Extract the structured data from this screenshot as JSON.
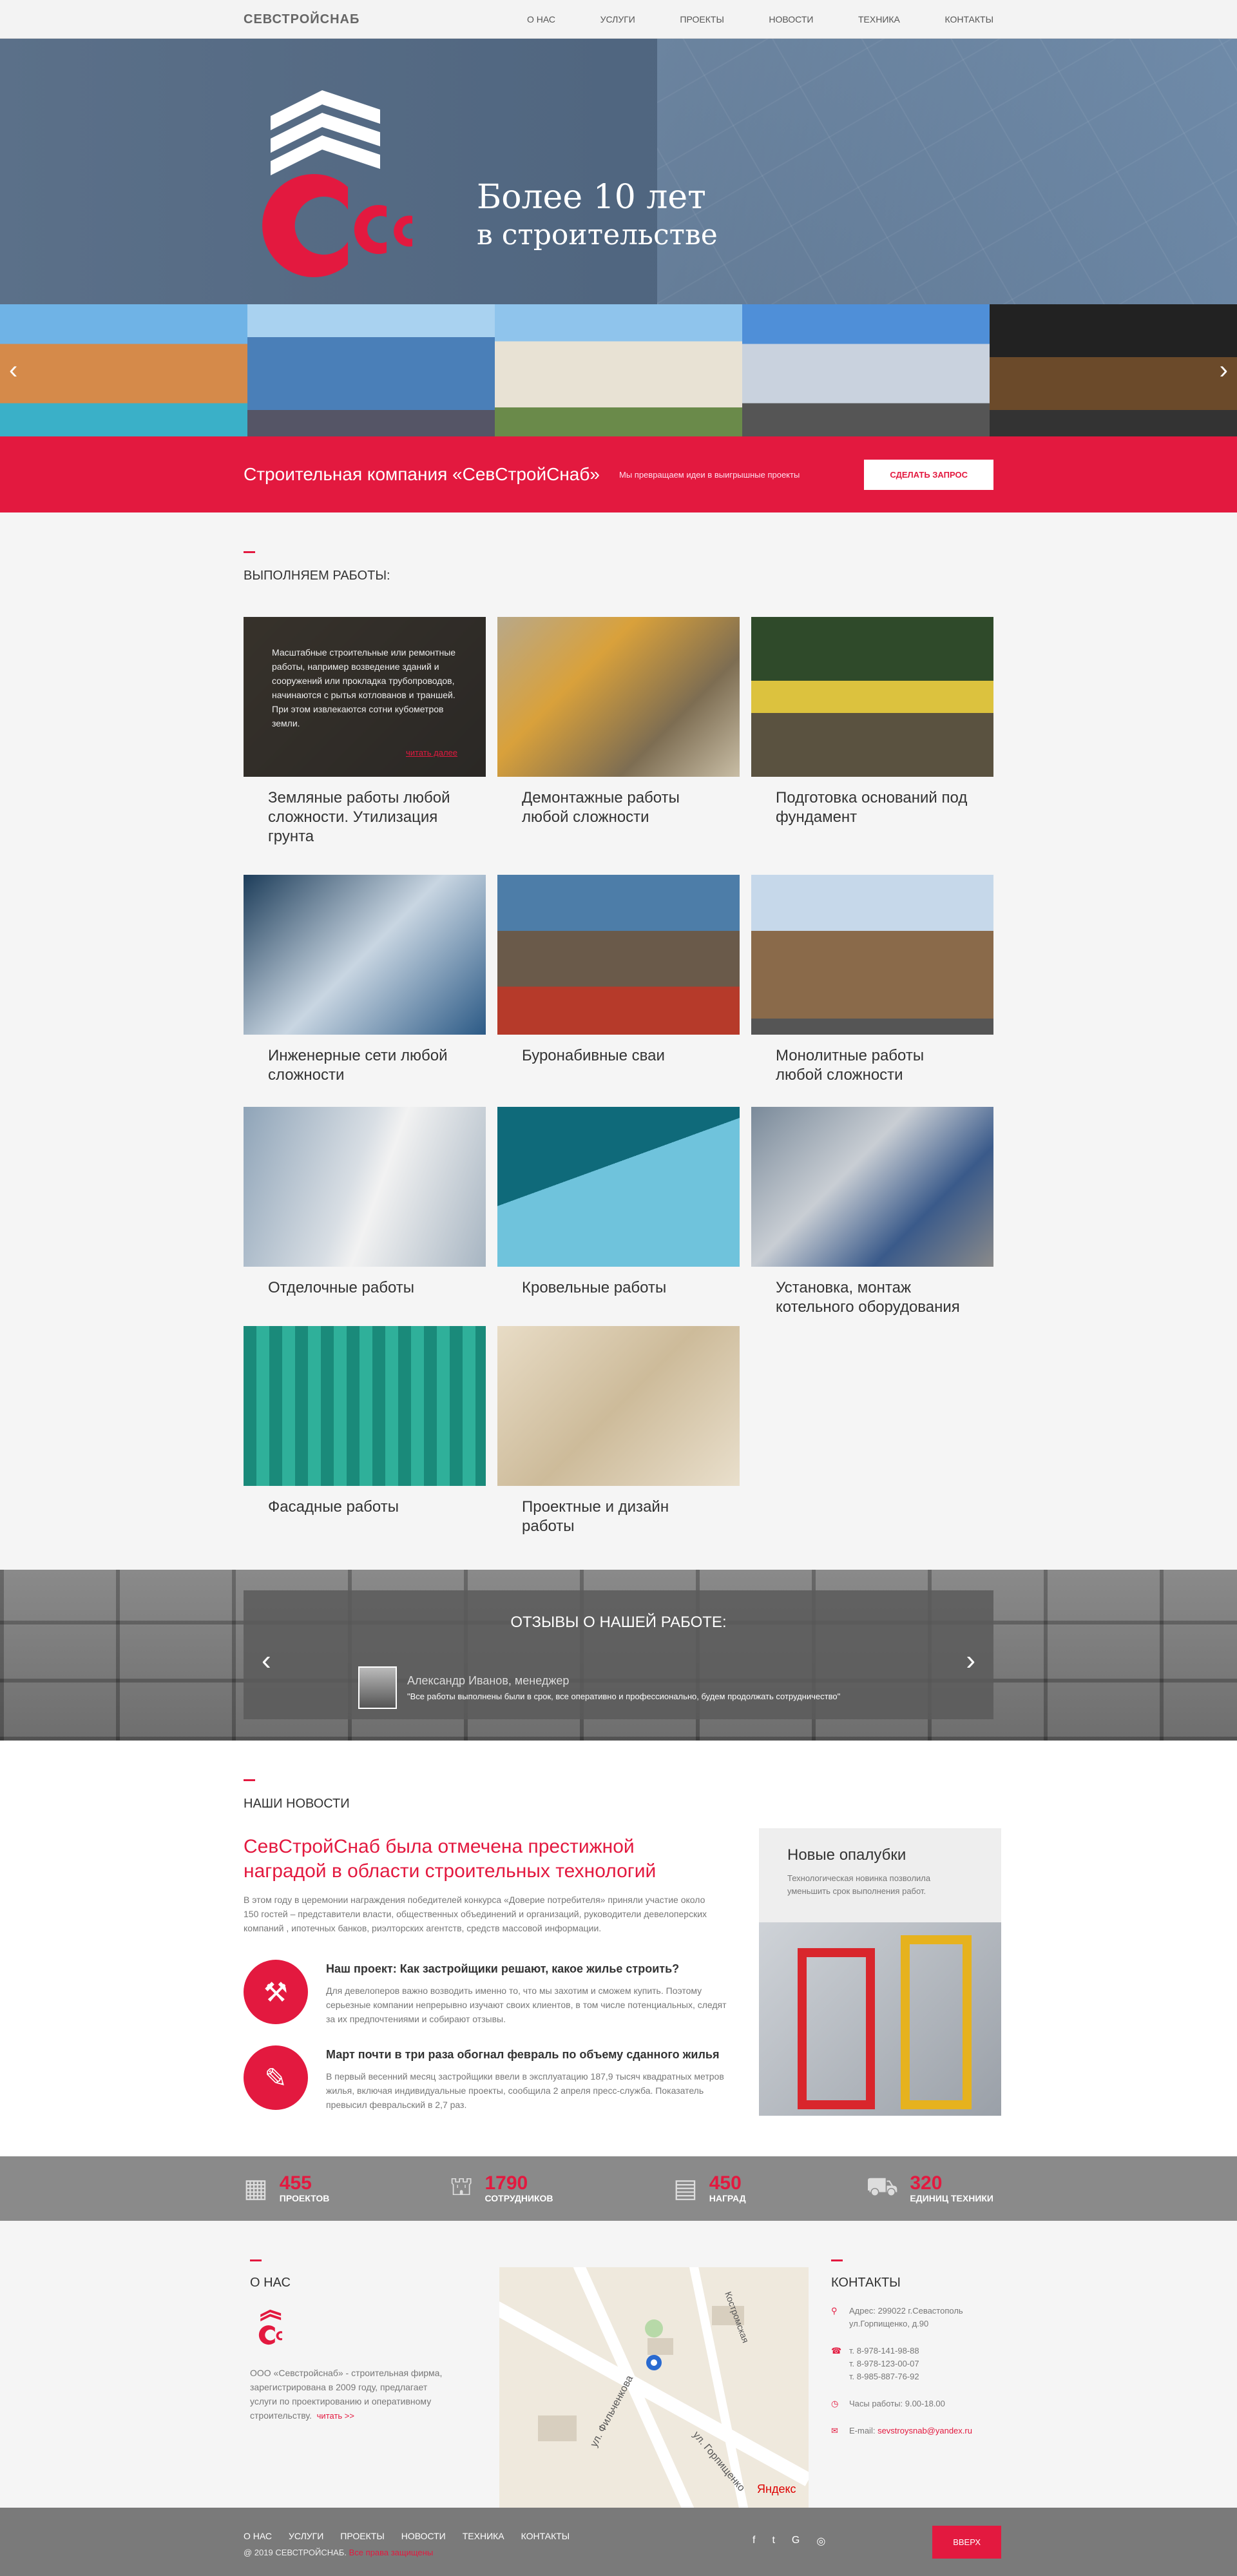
{
  "header": {
    "brand": "СЕВСТРОЙСНАБ",
    "nav": [
      "О НАС",
      "УСЛУГИ",
      "ПРОЕКТЫ",
      "НОВОСТИ",
      "ТЕХНИКА",
      "КОНТАКТЫ"
    ]
  },
  "hero": {
    "title_line1": "Более 10 лет",
    "title_line2": "в строительстве"
  },
  "cta": {
    "title": "Строительная компания «СевСтройСнаб»",
    "subtitle": "Мы превращаем идеи  в выигрышные проекты",
    "button": "СДЕЛАТЬ ЗАПРОС"
  },
  "services": {
    "heading": "ВЫПОЛНЯЕМ РАБОТЫ:",
    "overlay_text": "Масштабные строительные или ремонтные работы, например возведение зданий и сооружений или прокладка трубопроводов, начинаются с рытья котлованов и траншей. При этом извлекаются сотни кубометров земли.",
    "overlay_more": "читать далее",
    "items": [
      "Земляные работы любой сложности. Утилизация грунта",
      "Демонтажные работы любой сложности",
      "Подготовка оснований под фундамент",
      "Инженерные сети любой сложности",
      "Буронабивные сваи",
      "Монолитные работы любой сложности",
      "Отделочные работы",
      "Кровельные работы",
      "Установка, монтаж котельного оборудования",
      "Фасадные работы",
      "Проектные и дизайн работы"
    ]
  },
  "reviews": {
    "heading": "ОТЗЫВЫ О НАШЕЙ РАБОТЕ:",
    "author": "Александр Иванов, менеджер",
    "quote": "\"Все работы выполнены были в срок, все оперативно и профессионально, будем продолжать сотрудничество\""
  },
  "news": {
    "heading": "НАШИ НОВОСТИ",
    "lead_title": "СевСтройСнаб была отмечена престижной наградой в области строительных технологий",
    "lead_text": "В этом году в церемонии награждения победителей конкурса «Доверие потребителя» приняли участие около 150 гостей – представители власти, общественных объединений и организаций, руководители девелоперских компаний , ипотечных банков, риэлторских агентств, средств массовой информации.",
    "items": [
      {
        "title": "Наш проект: Как застройщики решают, какое жилье строить?",
        "text": "Для девелоперов важно возводить именно то, что мы захотим и сможем купить. Поэтому серьезные компании непрерывно изучают своих клиентов, в том числе потенциальных, следят за их предпочтениями и собирают отзывы."
      },
      {
        "title": "Март почти в три раза обогнал февраль по объему сданного жилья",
        "text": "В первый весенний месяц застройщики ввели в эксплуатацию 187,9 тысяч квадратных метров жилья, включая индивидуальные проекты, сообщила 2 апреля пресс-служба. Показатель превысил февральский в 2,7 раз."
      }
    ],
    "side": {
      "title": "Новые опалубки",
      "text": "Технологическая новинка позволила уменьшить срок выполнения работ."
    }
  },
  "stats": [
    {
      "num": "455",
      "label": "ПРОЕКТОВ",
      "icon": "building-icon"
    },
    {
      "num": "1790",
      "label": "СОТРУДНИКОВ",
      "icon": "crane-icon"
    },
    {
      "num": "450",
      "label": "НАГРАД",
      "icon": "certificate-icon"
    },
    {
      "num": "320",
      "label": "ЕДИНИЦ ТЕХНИКИ",
      "icon": "truck-icon"
    }
  ],
  "about": {
    "heading": "О НАС",
    "text": "ООО «Севстройснаб» - строительная фирма, зарегистрирована в 2009 году, предлагает услуги по проектированию и оперативному строительству.",
    "more": "читать >>"
  },
  "map": {
    "street1": "ул. Фильченкова",
    "street2": "ул. Горпищенко",
    "street3": "Костромская",
    "label": "Яндекс"
  },
  "contacts": {
    "heading": "КОНТАКТЫ",
    "address": "Адрес: 299022 г.Севастополь ул.Горпищенко, д.90",
    "phones": [
      "т. 8-978-141-98-88",
      "т. 8-978-123-00-07",
      "т. 8-985-887-76-92"
    ],
    "hours": "Часы работы: 9.00-18.00",
    "email_label": "E-mail:",
    "email": "sevstroysnab@yandex.ru"
  },
  "footer": {
    "nav": [
      "О НАС",
      "УСЛУГИ",
      "ПРОЕКТЫ",
      "НОВОСТИ",
      "ТЕХНИКА",
      "КОНТАКТЫ"
    ],
    "copyright": "@ 2019 СЕВСТРОЙСНАБ.",
    "rights": "Все права защищены",
    "social": [
      "f",
      "t",
      "G",
      "◎"
    ],
    "up_button": "ВВЕРХ"
  },
  "colors": {
    "accent": "#e3193f",
    "header_bg": "#f3f3f3",
    "stats_bg": "#8a8a8a",
    "footer_bg": "#7a7a7a"
  }
}
